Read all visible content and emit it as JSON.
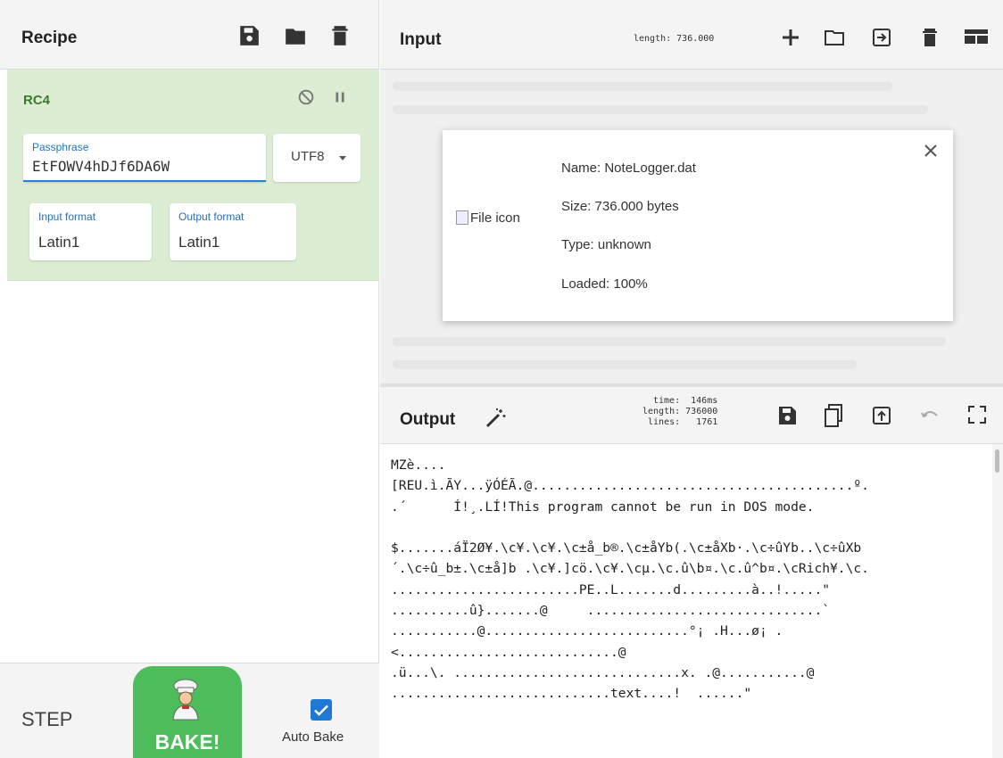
{
  "recipe": {
    "title": "Recipe",
    "icons": [
      "save-icon",
      "folder-icon",
      "trash-icon"
    ],
    "operation": {
      "name": "RC4",
      "passphrase_label": "Passphrase",
      "passphrase_value": "EtFOWV4hDJf6DA6W",
      "encoding": "UTF8",
      "input_format_label": "Input format",
      "input_format_value": "Latin1",
      "output_format_label": "Output format",
      "output_format_value": "Latin1"
    },
    "controls": {
      "step_label": "STEP",
      "bake_label": "BAKE!",
      "auto_bake_label": "Auto Bake",
      "auto_bake_checked": true
    }
  },
  "input": {
    "title": "Input",
    "length": "length: 736.000",
    "file": {
      "icon_alt": "File icon",
      "name": "Name: NoteLogger.dat",
      "size": "Size: 736.000 bytes",
      "type": "Type: unknown",
      "loaded": "Loaded: 100%"
    }
  },
  "output": {
    "title": "Output",
    "time": "time:  146ms",
    "length": "length: 736000",
    "lines": "lines:   1761",
    "text_lines": [
      "MZè....",
      "[REU.ì.ÃY...ÿÓÉÃ.@.........................................º.",
      ".´      Í!¸.LÍ!This program cannot be run in DOS mode.",
      "",
      "$.......áÏ2Ø¥.\\c¥.\\c¥.\\c±å_b®.\\c±åYb(.\\c±åXb·.\\c÷ûYb..\\c÷ûXb",
      "´.\\c÷û_b±.\\c±å]b .\\c¥.]cö.\\c¥.\\cµ.\\c.û\\b¤.\\c.û^b¤.\\cRich¥.\\c.",
      "........................PE..L.......d.........à..!.....\"",
      "..........û}.......@     ..............................`",
      "...........@..........................°¡ .H...ø¡ .",
      "<............................@",
      ".ü...\\. .............................x. .@...........@",
      "............................text....!  ......\""
    ]
  },
  "colors": {
    "accent": "#4dbd5c",
    "operation_bg": "#dcedd4",
    "checkbox": "#1f78d1"
  }
}
